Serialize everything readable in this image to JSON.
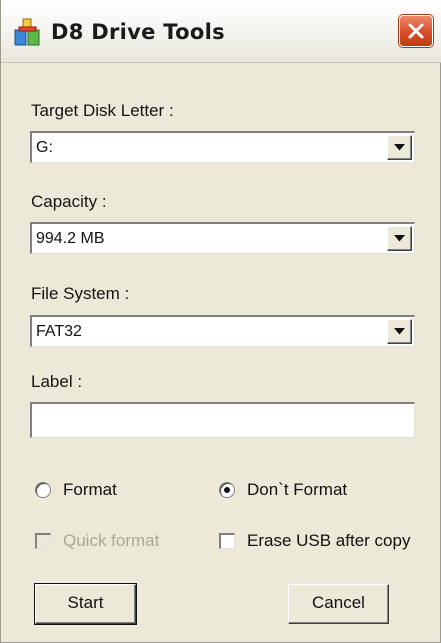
{
  "window": {
    "title": "D8 Drive Tools",
    "icon": "drive-tools-app-icon",
    "close_icon": "close-icon"
  },
  "fields": {
    "target_disk": {
      "label": "Target Disk Letter :",
      "value": "G:"
    },
    "capacity": {
      "label": "Capacity :",
      "value": "994.2 MB"
    },
    "file_system": {
      "label": "File System :",
      "value": "FAT32"
    },
    "volume_label": {
      "label": "Label :",
      "value": ""
    }
  },
  "format_options": {
    "format": {
      "label": "Format",
      "selected": false
    },
    "dont_format": {
      "label": "Don`t Format",
      "selected": true
    }
  },
  "checkboxes": {
    "quick_format": {
      "label": "Quick format",
      "checked": false,
      "enabled": false
    },
    "erase_usb": {
      "label": "Erase USB after copy",
      "checked": false,
      "enabled": true
    }
  },
  "buttons": {
    "start": "Start",
    "cancel": "Cancel"
  },
  "colors": {
    "dialog_background": "#ece9d8",
    "close_button": "#d8512c",
    "disabled_text": "#aca899"
  }
}
